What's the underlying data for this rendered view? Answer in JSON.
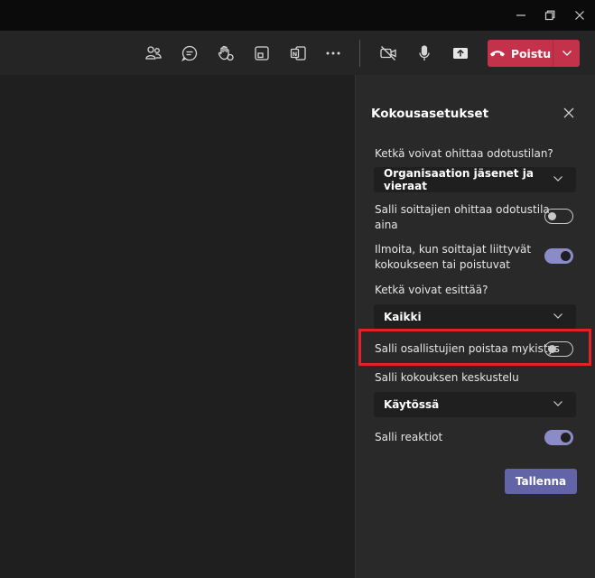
{
  "panel": {
    "title": "Kokousasetukset",
    "bypass_lobby": {
      "label": "Ketkä voivat ohittaa odotustilan?",
      "value": "Organisaation jäsenet ja vieraat"
    },
    "callers_bypass": {
      "label": "Salli soittajien ohittaa odotustila aina",
      "label_line1": "Salli soittajien ohittaa odotustila",
      "label_line2": "aina",
      "enabled": false
    },
    "notify_callers": {
      "label_line1": "Ilmoita, kun soittajat liittyvät",
      "label_line2": "kokoukseen tai poistuvat",
      "enabled": true
    },
    "who_present": {
      "label": "Ketkä voivat esittää?",
      "value": "Kaikki"
    },
    "allow_unmute": {
      "label": "Salli osallistujien poistaa mykistys",
      "enabled": false
    },
    "meeting_chat": {
      "label": "Salli kokouksen keskustelu",
      "value": "Käytössä"
    },
    "reactions": {
      "label": "Salli reaktiot",
      "enabled": true
    },
    "save_label": "Tallenna"
  },
  "toolbar": {
    "leave_label": "Poistu",
    "icons": [
      "people-icon",
      "chat-icon",
      "raise-hand-icon",
      "rooms-icon",
      "apps-icon",
      "more-icon",
      "camera-off-icon",
      "mic-icon",
      "share-icon"
    ],
    "leave_color": "#c4314b"
  },
  "colors": {
    "accent": "#6264a7",
    "highlight_box": "#e4202a"
  }
}
